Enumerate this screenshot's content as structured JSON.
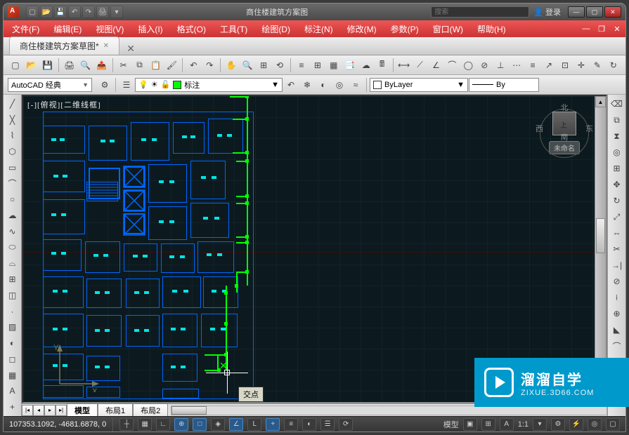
{
  "title_center": "商住楼建筑方案图",
  "search_placeholder": "搜索",
  "login_text": "登录",
  "menus": [
    "文件(F)",
    "编辑(E)",
    "视图(V)",
    "插入(I)",
    "格式(O)",
    "工具(T)",
    "绘图(D)",
    "标注(N)",
    "修改(M)",
    "参数(P)",
    "窗口(W)",
    "帮助(H)"
  ],
  "doc_tab": "商住楼建筑方案草图*",
  "workspace": "AutoCAD 经典",
  "layer_current": "标注",
  "linetype": "ByLayer",
  "linetype_right": "By",
  "viewport_label": "[-][俯视][二维线框]",
  "tooltip": "交点",
  "viewcube": {
    "n": "北",
    "s": "南",
    "e": "东",
    "w": "西",
    "top": "上",
    "tag": "未命名"
  },
  "ucs": {
    "x": "X",
    "y": "Y"
  },
  "model_tabs": [
    "模型",
    "布局1",
    "布局2"
  ],
  "coords": "107353.1092, -4681.6878, 0",
  "scale_annot": "1:1",
  "model_label": "模型",
  "watermark": {
    "brand": "溜溜自学",
    "url": "ZIXUE.3D66.COM"
  }
}
